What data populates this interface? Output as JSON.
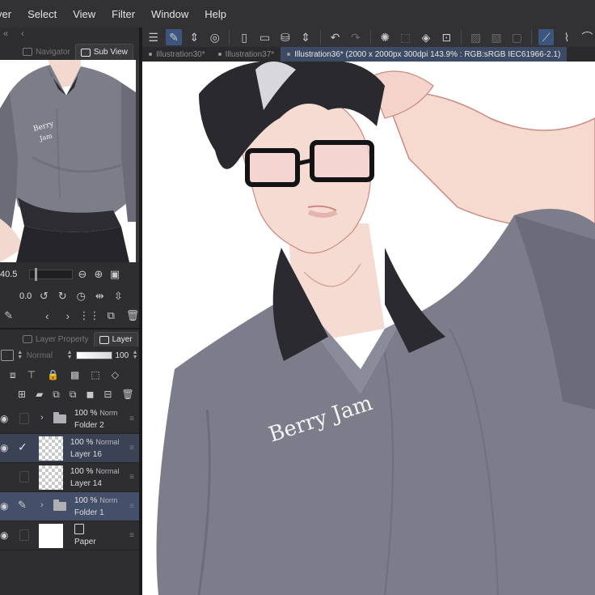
{
  "menu": [
    "yer",
    "Select",
    "View",
    "Filter",
    "Window",
    "Help"
  ],
  "dock": {
    "collapse_glyphs": [
      "«",
      "‹"
    ],
    "tabs": {
      "navigator": "Navigator",
      "sub_view": "Sub View"
    }
  },
  "navigator": {
    "zoom": "40.5",
    "rotation": "0.0"
  },
  "layer_panel": {
    "tabs": {
      "property": "Layer Property",
      "layer": "Layer"
    },
    "blend_mode": "Normal",
    "opacity": "100"
  },
  "layers": [
    {
      "opacity": "100 %",
      "mode": "Norm",
      "name": "Folder 2",
      "kind": "folder",
      "visible": true
    },
    {
      "opacity": "100 %",
      "mode": "Normal",
      "name": "Layer 16",
      "kind": "raster",
      "visible": true,
      "checked": true
    },
    {
      "opacity": "100 %",
      "mode": "Normal",
      "name": "Layer 14",
      "kind": "raster",
      "visible": false
    },
    {
      "opacity": "100 %",
      "mode": "Norm",
      "name": "Folder 1",
      "kind": "folder",
      "visible": true,
      "editing": true
    },
    {
      "opacity": "",
      "mode": "",
      "name": "Paper",
      "kind": "paper",
      "visible": true
    }
  ],
  "doc_tabs": [
    "Illustration30*",
    "Illustration37*",
    "Illustration36* (2000 x 2000px 300dpi 143.9% : RGB:sRGB IEC61966-2.1)"
  ],
  "canvas": {
    "signature": "Berry Jam"
  },
  "colors": {
    "accent": "#3d5680",
    "selected_layer": "#444f6a",
    "shirt": "#7a7a86",
    "hair": "#2a2a2e"
  }
}
